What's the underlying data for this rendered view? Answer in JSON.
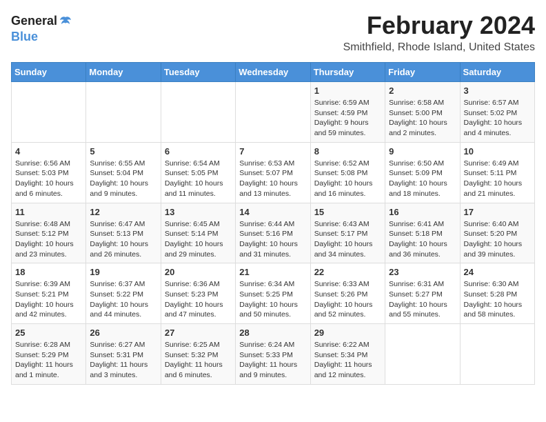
{
  "app": {
    "logo_text_general": "General",
    "logo_text_blue": "Blue"
  },
  "header": {
    "month_year": "February 2024",
    "location": "Smithfield, Rhode Island, United States"
  },
  "weekdays": [
    "Sunday",
    "Monday",
    "Tuesday",
    "Wednesday",
    "Thursday",
    "Friday",
    "Saturday"
  ],
  "weeks": [
    [
      {
        "day": "",
        "info": ""
      },
      {
        "day": "",
        "info": ""
      },
      {
        "day": "",
        "info": ""
      },
      {
        "day": "",
        "info": ""
      },
      {
        "day": "1",
        "info": "Sunrise: 6:59 AM\nSunset: 4:59 PM\nDaylight: 9 hours\nand 59 minutes."
      },
      {
        "day": "2",
        "info": "Sunrise: 6:58 AM\nSunset: 5:00 PM\nDaylight: 10 hours\nand 2 minutes."
      },
      {
        "day": "3",
        "info": "Sunrise: 6:57 AM\nSunset: 5:02 PM\nDaylight: 10 hours\nand 4 minutes."
      }
    ],
    [
      {
        "day": "4",
        "info": "Sunrise: 6:56 AM\nSunset: 5:03 PM\nDaylight: 10 hours\nand 6 minutes."
      },
      {
        "day": "5",
        "info": "Sunrise: 6:55 AM\nSunset: 5:04 PM\nDaylight: 10 hours\nand 9 minutes."
      },
      {
        "day": "6",
        "info": "Sunrise: 6:54 AM\nSunset: 5:05 PM\nDaylight: 10 hours\nand 11 minutes."
      },
      {
        "day": "7",
        "info": "Sunrise: 6:53 AM\nSunset: 5:07 PM\nDaylight: 10 hours\nand 13 minutes."
      },
      {
        "day": "8",
        "info": "Sunrise: 6:52 AM\nSunset: 5:08 PM\nDaylight: 10 hours\nand 16 minutes."
      },
      {
        "day": "9",
        "info": "Sunrise: 6:50 AM\nSunset: 5:09 PM\nDaylight: 10 hours\nand 18 minutes."
      },
      {
        "day": "10",
        "info": "Sunrise: 6:49 AM\nSunset: 5:11 PM\nDaylight: 10 hours\nand 21 minutes."
      }
    ],
    [
      {
        "day": "11",
        "info": "Sunrise: 6:48 AM\nSunset: 5:12 PM\nDaylight: 10 hours\nand 23 minutes."
      },
      {
        "day": "12",
        "info": "Sunrise: 6:47 AM\nSunset: 5:13 PM\nDaylight: 10 hours\nand 26 minutes."
      },
      {
        "day": "13",
        "info": "Sunrise: 6:45 AM\nSunset: 5:14 PM\nDaylight: 10 hours\nand 29 minutes."
      },
      {
        "day": "14",
        "info": "Sunrise: 6:44 AM\nSunset: 5:16 PM\nDaylight: 10 hours\nand 31 minutes."
      },
      {
        "day": "15",
        "info": "Sunrise: 6:43 AM\nSunset: 5:17 PM\nDaylight: 10 hours\nand 34 minutes."
      },
      {
        "day": "16",
        "info": "Sunrise: 6:41 AM\nSunset: 5:18 PM\nDaylight: 10 hours\nand 36 minutes."
      },
      {
        "day": "17",
        "info": "Sunrise: 6:40 AM\nSunset: 5:20 PM\nDaylight: 10 hours\nand 39 minutes."
      }
    ],
    [
      {
        "day": "18",
        "info": "Sunrise: 6:39 AM\nSunset: 5:21 PM\nDaylight: 10 hours\nand 42 minutes."
      },
      {
        "day": "19",
        "info": "Sunrise: 6:37 AM\nSunset: 5:22 PM\nDaylight: 10 hours\nand 44 minutes."
      },
      {
        "day": "20",
        "info": "Sunrise: 6:36 AM\nSunset: 5:23 PM\nDaylight: 10 hours\nand 47 minutes."
      },
      {
        "day": "21",
        "info": "Sunrise: 6:34 AM\nSunset: 5:25 PM\nDaylight: 10 hours\nand 50 minutes."
      },
      {
        "day": "22",
        "info": "Sunrise: 6:33 AM\nSunset: 5:26 PM\nDaylight: 10 hours\nand 52 minutes."
      },
      {
        "day": "23",
        "info": "Sunrise: 6:31 AM\nSunset: 5:27 PM\nDaylight: 10 hours\nand 55 minutes."
      },
      {
        "day": "24",
        "info": "Sunrise: 6:30 AM\nSunset: 5:28 PM\nDaylight: 10 hours\nand 58 minutes."
      }
    ],
    [
      {
        "day": "25",
        "info": "Sunrise: 6:28 AM\nSunset: 5:29 PM\nDaylight: 11 hours\nand 1 minute."
      },
      {
        "day": "26",
        "info": "Sunrise: 6:27 AM\nSunset: 5:31 PM\nDaylight: 11 hours\nand 3 minutes."
      },
      {
        "day": "27",
        "info": "Sunrise: 6:25 AM\nSunset: 5:32 PM\nDaylight: 11 hours\nand 6 minutes."
      },
      {
        "day": "28",
        "info": "Sunrise: 6:24 AM\nSunset: 5:33 PM\nDaylight: 11 hours\nand 9 minutes."
      },
      {
        "day": "29",
        "info": "Sunrise: 6:22 AM\nSunset: 5:34 PM\nDaylight: 11 hours\nand 12 minutes."
      },
      {
        "day": "",
        "info": ""
      },
      {
        "day": "",
        "info": ""
      }
    ]
  ]
}
